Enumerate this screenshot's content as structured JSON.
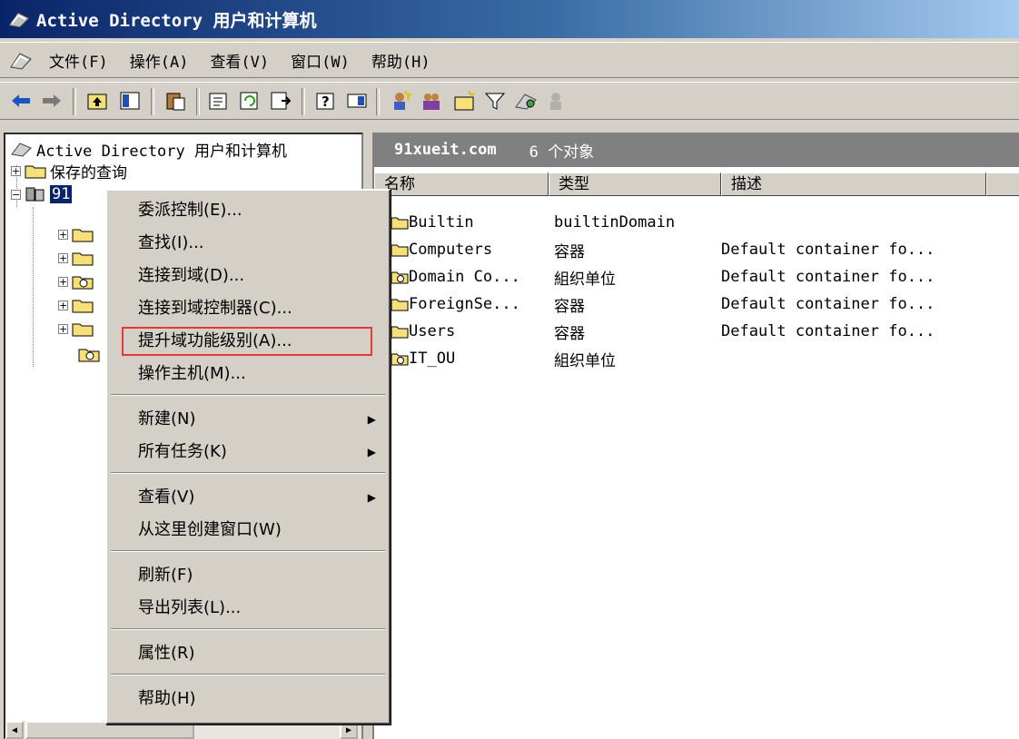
{
  "window": {
    "title": "Active Directory 用户和计算机"
  },
  "menubar": {
    "items": [
      "文件(F)",
      "操作(A)",
      "查看(V)",
      "窗口(W)",
      "帮助(H)"
    ]
  },
  "tree": {
    "root": "Active Directory 用户和计算机",
    "saved_queries": "保存的查询",
    "domain_stub": "91"
  },
  "result": {
    "domain": "91xueit.com",
    "count": "6 个对象",
    "columns": [
      "名称",
      "类型",
      "描述"
    ],
    "rows": [
      {
        "name": "Builtin",
        "type": "builtinDomain",
        "desc": ""
      },
      {
        "name": "Computers",
        "type": "容器",
        "desc": "Default container fo..."
      },
      {
        "name": "Domain Co...",
        "type": "組织单位",
        "desc": "Default container fo..."
      },
      {
        "name": "ForeignSe...",
        "type": "容器",
        "desc": "Default container fo..."
      },
      {
        "name": "Users",
        "type": "容器",
        "desc": "Default container fo..."
      },
      {
        "name": "IT_OU",
        "type": "組织单位",
        "desc": ""
      }
    ]
  },
  "context_menu": {
    "delegate": "委派控制(E)...",
    "find": "查找(I)...",
    "connect_domain": "连接到域(D)...",
    "connect_dc": "连接到域控制器(C)...",
    "raise_level": "提升域功能级别(A)...",
    "operations_master": "操作主机(M)...",
    "new": "新建(N)",
    "all_tasks": "所有任务(K)",
    "view": "查看(V)",
    "new_window": "从这里创建窗口(W)",
    "refresh": "刷新(F)",
    "export": "导出列表(L)...",
    "properties": "属性(R)",
    "help": "帮助(H)"
  },
  "highlight_color": "#e53935"
}
